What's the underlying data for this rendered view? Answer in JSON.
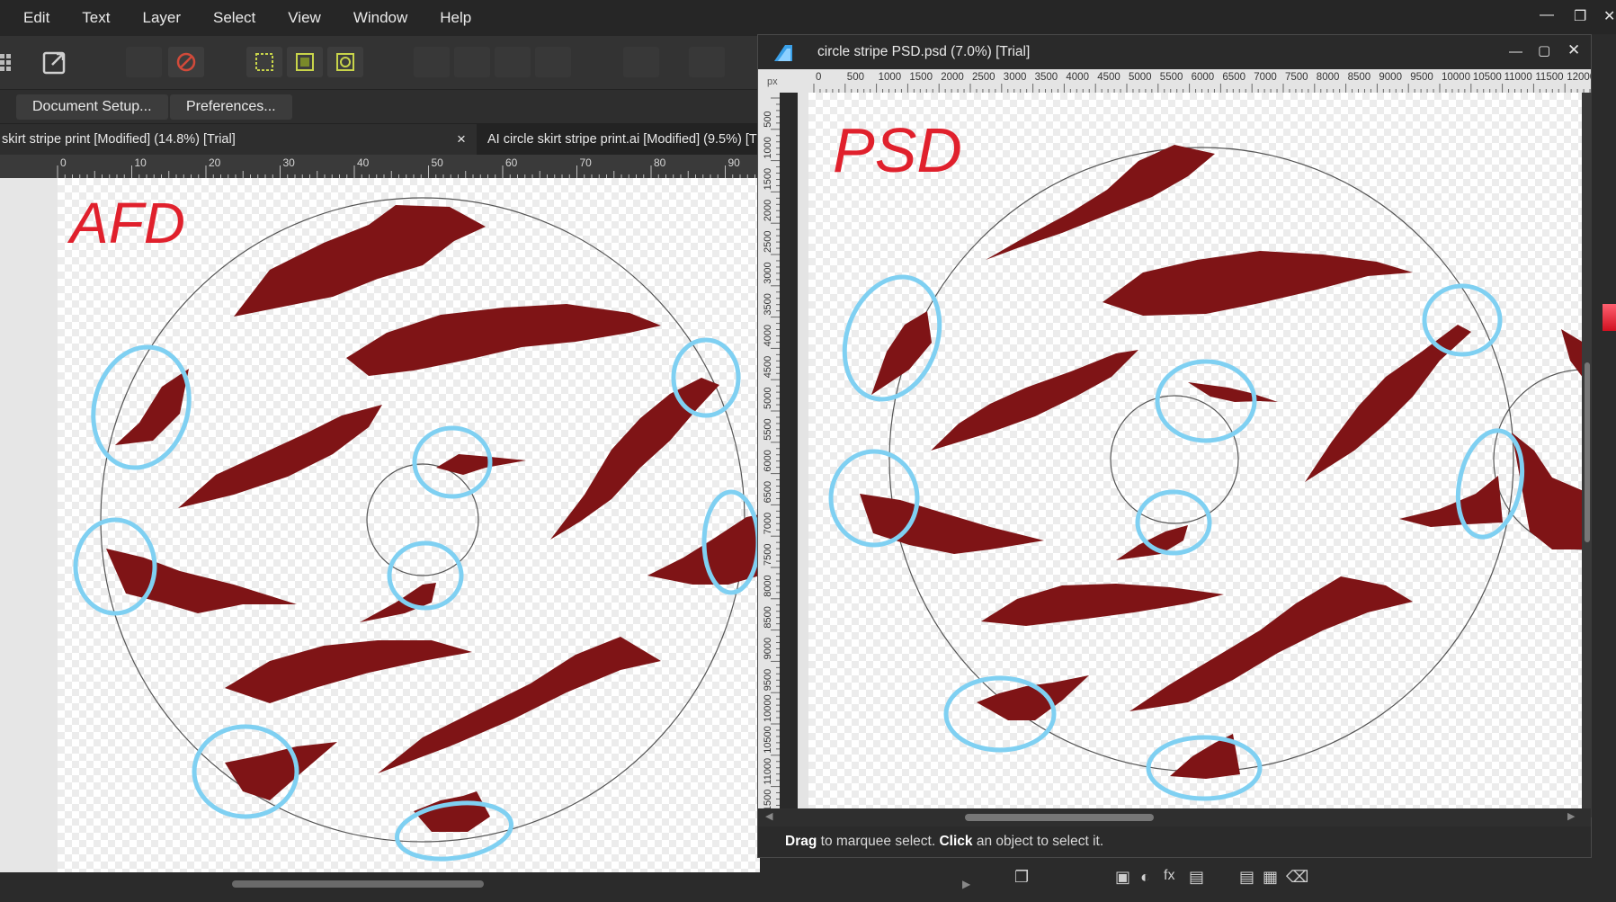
{
  "menu": {
    "items": [
      "Edit",
      "Text",
      "Layer",
      "Select",
      "View",
      "Window",
      "Help"
    ]
  },
  "context_toolbar": {
    "document_setup": "Document Setup...",
    "preferences": "Preferences..."
  },
  "tabs": [
    {
      "label": "skirt stripe print [Modified] (14.8%) [Trial]"
    },
    {
      "label": "AI circle skirt stripe print.ai [Modified] (9.5%) [Tr"
    }
  ],
  "tab_close": "×",
  "left_ruler": {
    "ticks": [
      "0",
      "10",
      "20",
      "30",
      "40",
      "50",
      "60",
      "70",
      "80",
      "90"
    ]
  },
  "left_canvas": {
    "handwritten_label": "AFD"
  },
  "psd_window": {
    "title": "circle stripe PSD.psd (7.0%) [Trial]",
    "ruler_unit": "px",
    "ruler_h_ticks": [
      "0",
      "500",
      "1000",
      "1500",
      "2000",
      "2500",
      "3000",
      "3500",
      "4000",
      "4500",
      "5000",
      "5500",
      "6000",
      "6500",
      "7000",
      "7500",
      "8000",
      "8500",
      "9000",
      "9500",
      "10000",
      "10500",
      "11000",
      "11500",
      "12000"
    ],
    "ruler_v_ticks": [
      "500",
      "1000",
      "1500",
      "2000",
      "2500",
      "3000",
      "3500",
      "4000",
      "4500",
      "5000",
      "5500",
      "6000",
      "6500",
      "7000",
      "7500",
      "8000",
      "8500",
      "9000",
      "9500",
      "10000",
      "10500",
      "11000",
      "11500"
    ],
    "handwritten_label": "PSD",
    "status": {
      "bold1": "Drag",
      "text1": " to marquee select. ",
      "bold2": "Click",
      "text2": " an object to select it."
    }
  },
  "colors": {
    "stripe": "#7f1416",
    "highlight": "#7fd0f2",
    "handwriting": "#e0202c"
  },
  "icons": [
    "minimize-icon",
    "restore-icon",
    "maximize-icon",
    "close-icon",
    "export-persona-icon",
    "app-logo-icon",
    "layers-icon",
    "trash-icon"
  ]
}
